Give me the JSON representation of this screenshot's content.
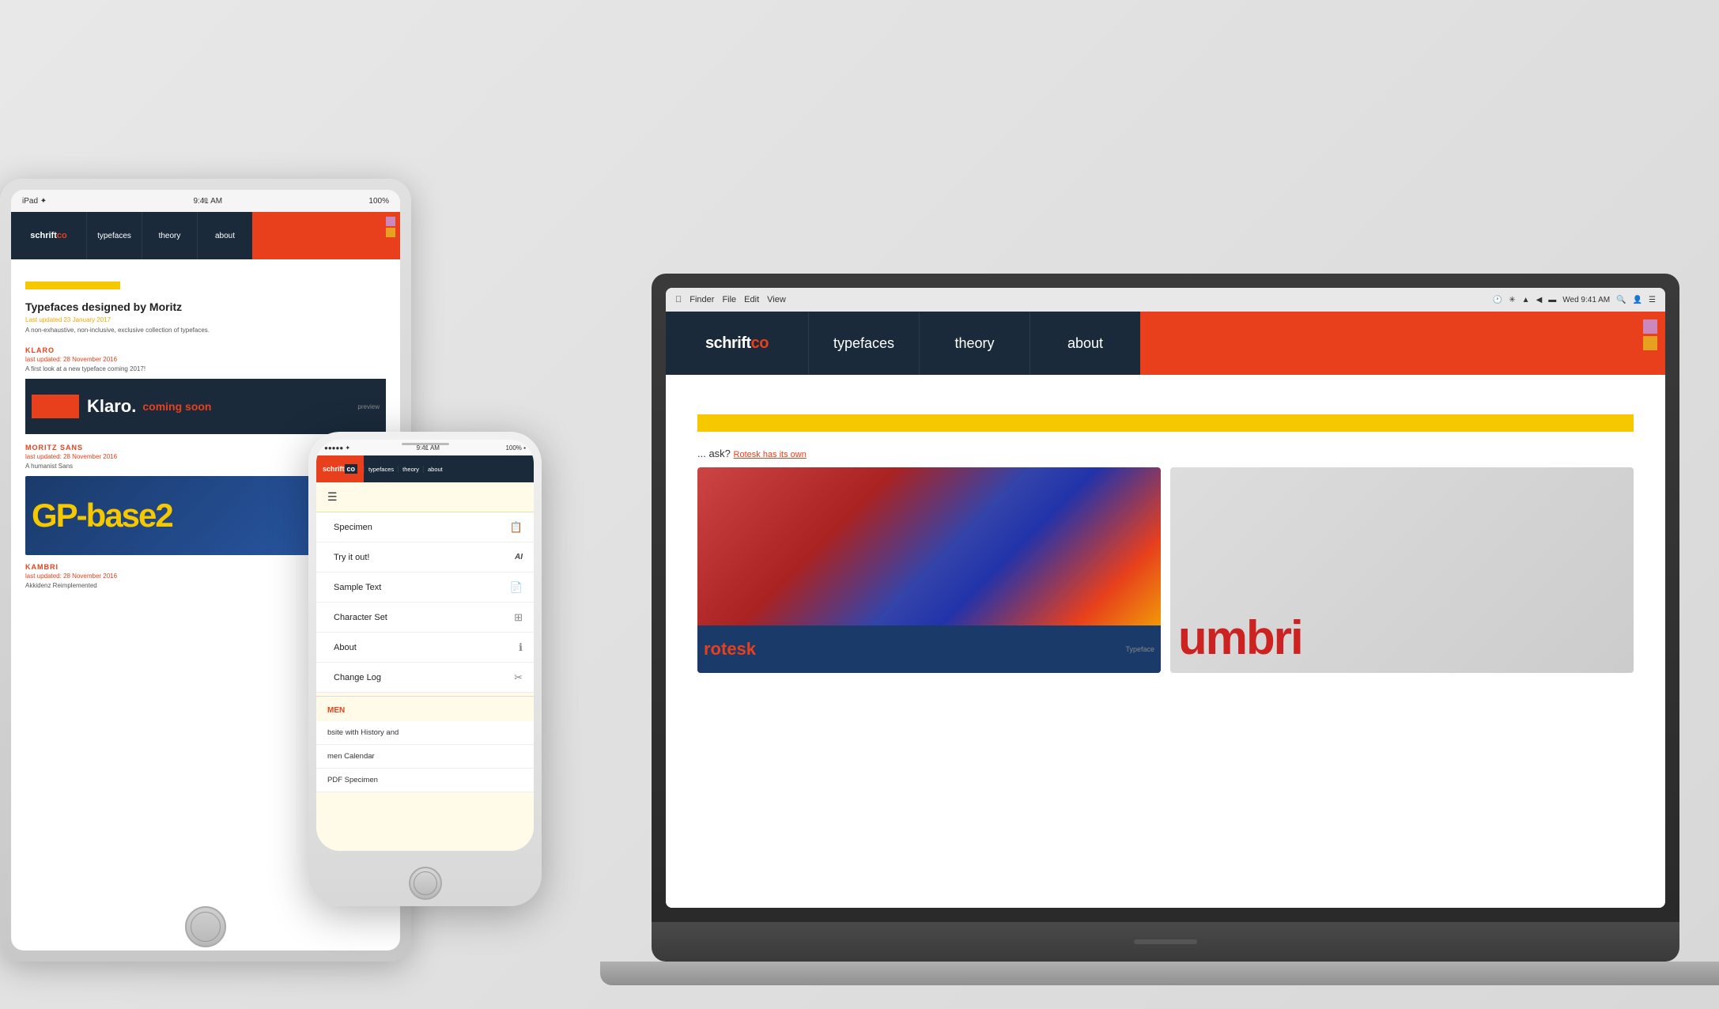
{
  "scene": {
    "background": "#e0e0e0"
  },
  "laptop": {
    "menubar": {
      "time": "Wed 9:41 AM",
      "wifi_icon": "wifi",
      "battery_icon": "battery"
    },
    "nav": {
      "brand": "schrift",
      "brand_accent": "co",
      "items": [
        "typefaces",
        "theory",
        "about"
      ]
    },
    "content": {
      "yellow_text": "",
      "body_text": "Rotesk has its own",
      "image_letters": "umbri"
    }
  },
  "ipad": {
    "statusbar": {
      "left": "iPad ✦",
      "center": "9:41 AM",
      "right": "100%"
    },
    "nav": {
      "brand": "schrift",
      "brand_accent": "co",
      "items": [
        "typefaces",
        "theory",
        "about"
      ]
    },
    "content": {
      "title": "Typefaces designed by Moritz",
      "updated": "Last updated 23 January 2017",
      "desc": "A non-exhaustive, non-inclusive, exclusive collection of typefaces.",
      "typefaces": [
        {
          "name": "KLARO",
          "updated": "last updated: 28 November 2016",
          "desc": "A first look at a new typeface coming 2017!",
          "display": "Klaro.",
          "display2": "coming soon",
          "preview_label": "preview"
        },
        {
          "name": "MORITZ SANS",
          "updated": "last updated: 28 November 2016",
          "desc": "A humanist Sans",
          "display": "GP-base2"
        },
        {
          "name": "KAMBRI",
          "updated": "last updated: 28 November 2016",
          "desc": "Akkidenz Reimplemented"
        }
      ]
    }
  },
  "iphone": {
    "statusbar": {
      "left": "●●●●● ✦",
      "center": "9:41 AM",
      "right": "100% ▪"
    },
    "nav": {
      "brand": "schrift",
      "brand_accent": "co",
      "items": [
        "typefaces",
        "theory",
        "about"
      ]
    },
    "menu": {
      "items": [
        {
          "label": "Specimen",
          "icon": "📋"
        },
        {
          "label": "Try it out!",
          "icon": "AI"
        },
        {
          "label": "Sample Text",
          "icon": "📄"
        },
        {
          "label": "Character Set",
          "icon": "⊞"
        },
        {
          "label": "About",
          "icon": "ℹ"
        },
        {
          "label": "Change Log",
          "icon": "✂"
        }
      ]
    },
    "content_sections": [
      {
        "label": "MEN"
      },
      {
        "label": "bsite with History and"
      },
      {
        "label": "men Calendar"
      },
      {
        "label": "PDF Specimen"
      }
    ]
  }
}
